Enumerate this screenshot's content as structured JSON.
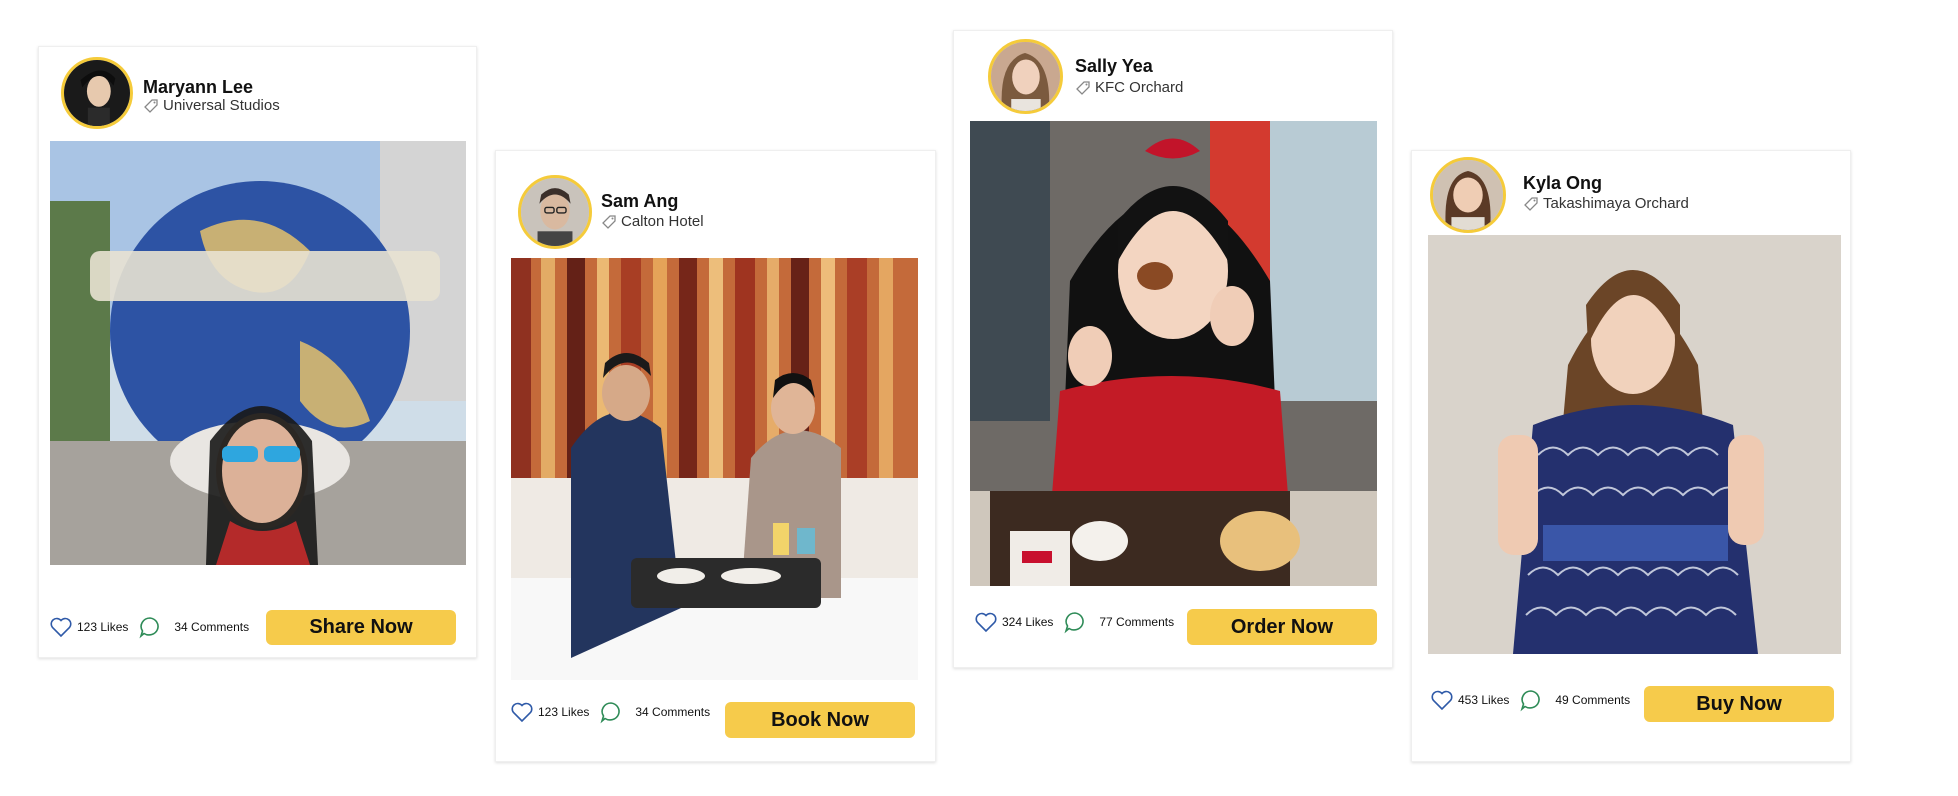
{
  "colors": {
    "accent": "#f6cb4b",
    "avatar_ring": "#f5cb3a",
    "like_icon": "#2f5aa8",
    "comment_icon": "#2e8b57"
  },
  "icons": {
    "like": "heart-outline-icon",
    "comment": "speech-bubble-icon",
    "location": "tag-icon"
  },
  "posts": [
    {
      "user": "Maryann Lee",
      "location": "Universal Studios",
      "likes": "123 Likes",
      "comments": "34 Comments",
      "cta": "Share Now"
    },
    {
      "user": "Sam Ang",
      "location": "Calton Hotel",
      "likes": "123 Likes",
      "comments": "34 Comments",
      "cta": "Book Now"
    },
    {
      "user": "Sally Yea",
      "location": "KFC Orchard",
      "likes": "324 Likes",
      "comments": "77 Comments",
      "cta": "Order Now"
    },
    {
      "user": "Kyla Ong",
      "location": "Takashimaya Orchard",
      "likes": "453 Likes",
      "comments": "49 Comments",
      "cta": "Buy Now"
    }
  ]
}
